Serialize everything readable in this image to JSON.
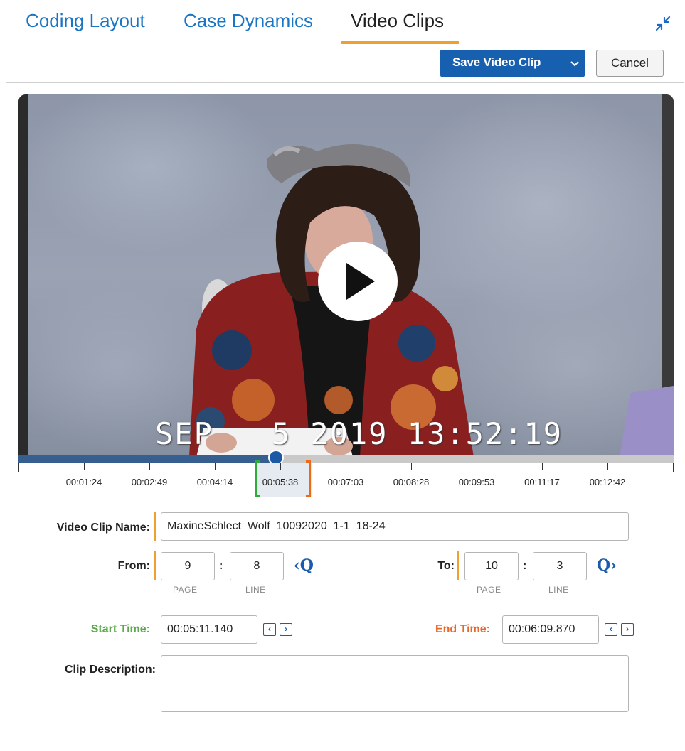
{
  "tabs": [
    {
      "label": "Coding Layout",
      "active": false
    },
    {
      "label": "Case Dynamics",
      "active": false
    },
    {
      "label": "Video Clips",
      "active": true
    }
  ],
  "header_icon": "collapse-arrows-icon",
  "toolbar": {
    "save_label": "Save Video Clip",
    "save_dropdown_icon": "chevron-down-icon",
    "cancel_label": "Cancel",
    "save_color": "#1760b0"
  },
  "video": {
    "overlay_timestamp": "SEP   5 2019 13:52:19",
    "play_icon": "play-icon",
    "progress_fraction": 0.393
  },
  "timeline": {
    "ticks": [
      "00:01:24",
      "00:02:49",
      "00:04:14",
      "00:05:38",
      "00:07:03",
      "00:08:28",
      "00:09:53",
      "00:11:17",
      "00:12:42"
    ],
    "clip_start_color": "#2eab38",
    "clip_end_color": "#ec6a18"
  },
  "form": {
    "clip_name_label": "Video Clip Name:",
    "clip_name_value": "MaxineSchlect_Wolf_10092020_1-1_18-24",
    "from_label": "From:",
    "from_page": "9",
    "from_line": "8",
    "to_label": "To:",
    "to_page": "10",
    "to_line": "3",
    "page_sub": "PAGE",
    "line_sub": "LINE",
    "colon": ":",
    "from_q": "‹Q",
    "to_q": "Q›",
    "start_time_label": "Start Time:",
    "start_time_value": "00:05:11.140",
    "end_time_label": "End Time:",
    "end_time_value": "00:06:09.870",
    "prev_symbol": "‹",
    "next_symbol": "›",
    "description_label": "Clip Description:",
    "description_value": "",
    "start_color": "#5aaa4a",
    "end_color": "#e8682a"
  }
}
